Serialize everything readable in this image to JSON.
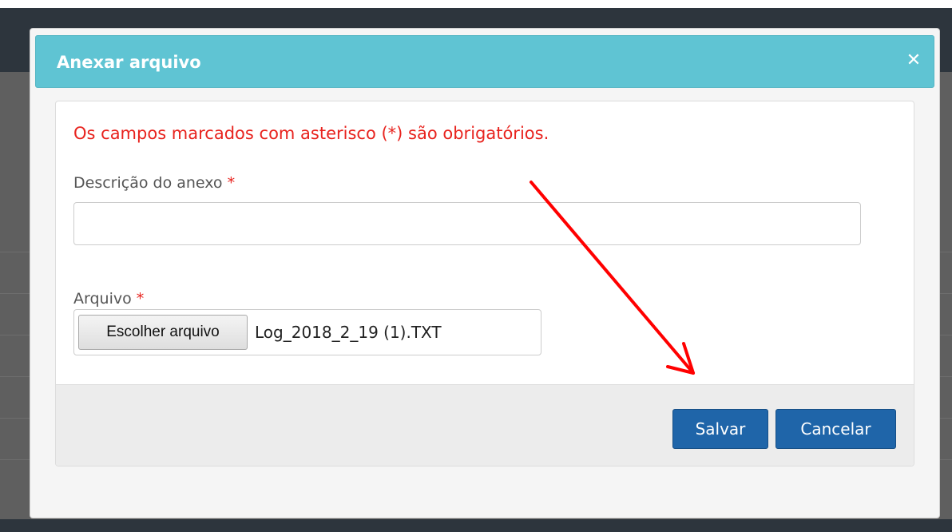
{
  "modal": {
    "title": "Anexar arquivo",
    "close_icon": "close-icon",
    "header_color": "#5fc4d3"
  },
  "form": {
    "required_note": "Os campos marcados com asterisco (*) são obrigatórios.",
    "required_marker": "*",
    "description": {
      "label": "Descrição do anexo",
      "value": "",
      "placeholder": ""
    },
    "file": {
      "label": "Arquivo",
      "button_label": "Escolher arquivo",
      "file_name": "Log_2018_2_19 (1).TXT"
    }
  },
  "footer": {
    "save_label": "Salvar",
    "cancel_label": "Cancelar",
    "button_color": "#1f65a9"
  },
  "annotation": {
    "type": "arrow",
    "color": "#ff0000",
    "points_to": "save-button"
  }
}
